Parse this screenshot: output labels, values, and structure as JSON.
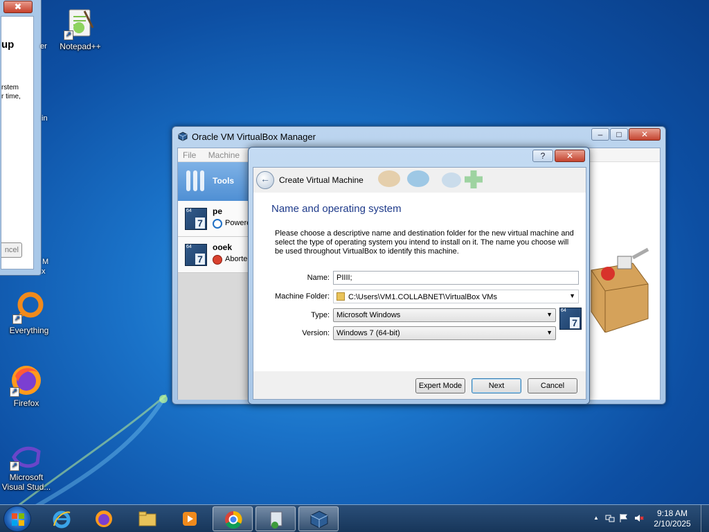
{
  "left_window": {
    "close_label": "✖",
    "title_fragment": "up",
    "text_lines": [
      "rstem",
      "r time,"
    ],
    "cancel_label": "ncel"
  },
  "desktop_fragments": [
    "er",
    "in",
    "M",
    "x"
  ],
  "desktop_icons": [
    {
      "label": "Notepad++"
    },
    {
      "label": "Everything"
    },
    {
      "label": "Firefox"
    },
    {
      "label": "Microsoft Visual Stud..."
    }
  ],
  "vbox_manager": {
    "title": "Oracle VM VirtualBox Manager",
    "controls": {
      "minimize": "–",
      "maximize": "□",
      "close": "✕"
    },
    "menu": [
      "File",
      "Machine"
    ],
    "tools_label": "Tools",
    "vms": [
      {
        "name": "pe",
        "state": "Powere",
        "badge_bits": "64",
        "badge_version": "7"
      },
      {
        "name": "ooek",
        "state": "Aborte",
        "badge_bits": "64",
        "badge_version": "7"
      }
    ]
  },
  "dialog": {
    "help_label": "?",
    "close_label": "✕",
    "header_title": "Create Virtual Machine",
    "section_title": "Name and operating system",
    "description": "Please choose a descriptive name and destination folder for the new virtual machine and select the type of operating system you intend to install on it. The name you choose will be used throughout VirtualBox to identify this machine.",
    "name_label": "Name:",
    "name_value": "PIIII;",
    "folder_label": "Machine Folder:",
    "folder_value": "C:\\Users\\VM1.COLLABNET\\VirtualBox VMs",
    "type_label": "Type:",
    "type_value": "Microsoft Windows",
    "version_label": "Version:",
    "version_value": "Windows 7 (64-bit)",
    "os_badge_bits": "64",
    "os_badge_version": "7",
    "buttons": {
      "expert": "Expert Mode",
      "next": "Next",
      "cancel": "Cancel"
    }
  },
  "taskbar": {
    "items": [
      {
        "icon": "internet-explorer-icon"
      },
      {
        "icon": "firefox-icon"
      },
      {
        "icon": "file-explorer-icon"
      },
      {
        "icon": "media-player-icon"
      },
      {
        "icon": "chrome-icon"
      },
      {
        "icon": "network-setup-icon"
      },
      {
        "icon": "virtualbox-icon"
      }
    ],
    "tray_expand": "▲",
    "time": "9:18 AM",
    "date": "2/10/2025"
  },
  "colors": {
    "desktop": "#1a72c8",
    "section_title": "#1e3a8a",
    "taskbar": "#17365a"
  }
}
